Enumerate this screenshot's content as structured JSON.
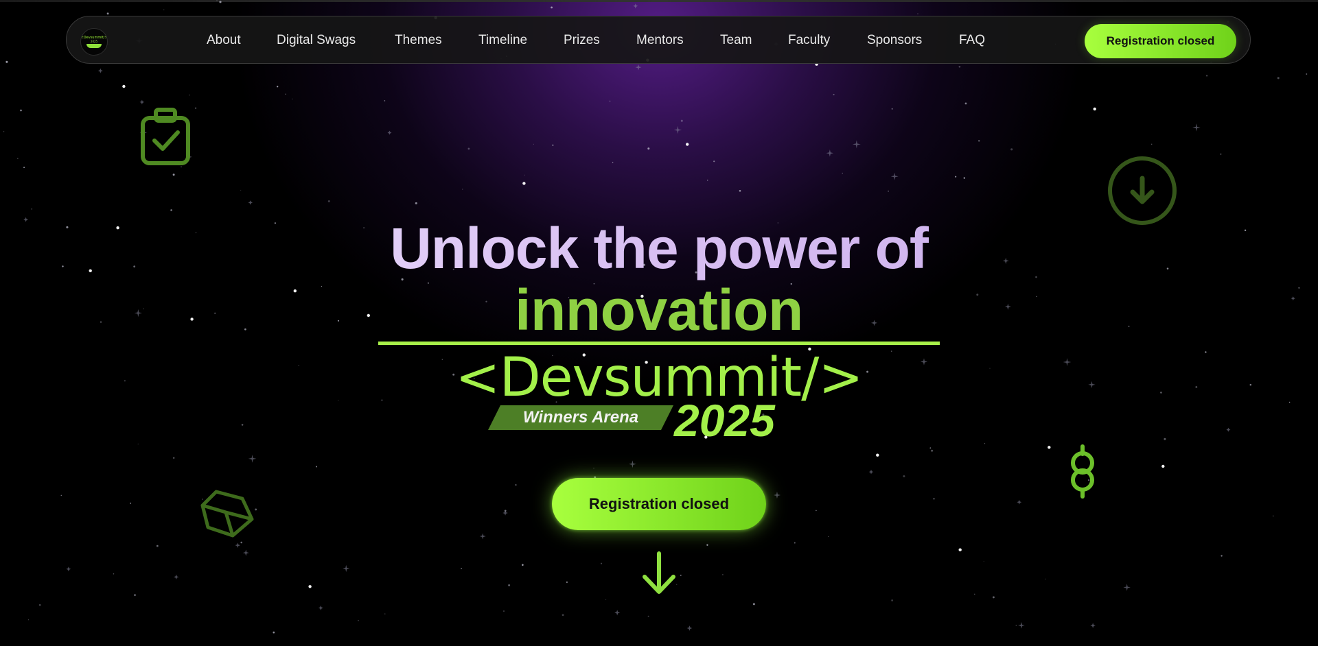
{
  "navbar": {
    "logo": {
      "title": "<Devsummit/>",
      "subtitle": "2025"
    },
    "links": [
      {
        "label": "About"
      },
      {
        "label": "Digital Swags"
      },
      {
        "label": "Themes"
      },
      {
        "label": "Timeline"
      },
      {
        "label": "Prizes"
      },
      {
        "label": "Mentors"
      },
      {
        "label": "Team"
      },
      {
        "label": "Faculty"
      },
      {
        "label": "Sponsors"
      },
      {
        "label": "FAQ"
      }
    ],
    "cta_label": "Registration closed"
  },
  "hero": {
    "headline_line1": "Unlock the power of",
    "headline_line2": "innovation",
    "brand": "<Devsummit/>",
    "tagline": "Winners Arena",
    "year": "2025",
    "cta_label": "Registration closed"
  },
  "decorations": {
    "icons": [
      "clipboard-check-icon",
      "download-circle-icon",
      "cube-icon",
      "dollar-icon",
      "arrow-down-icon"
    ]
  },
  "colors": {
    "accent_green": "#a3f04a",
    "headline_lavender": "#dcc5f5",
    "background": "#000000",
    "glow_purple": "#581e8c"
  }
}
